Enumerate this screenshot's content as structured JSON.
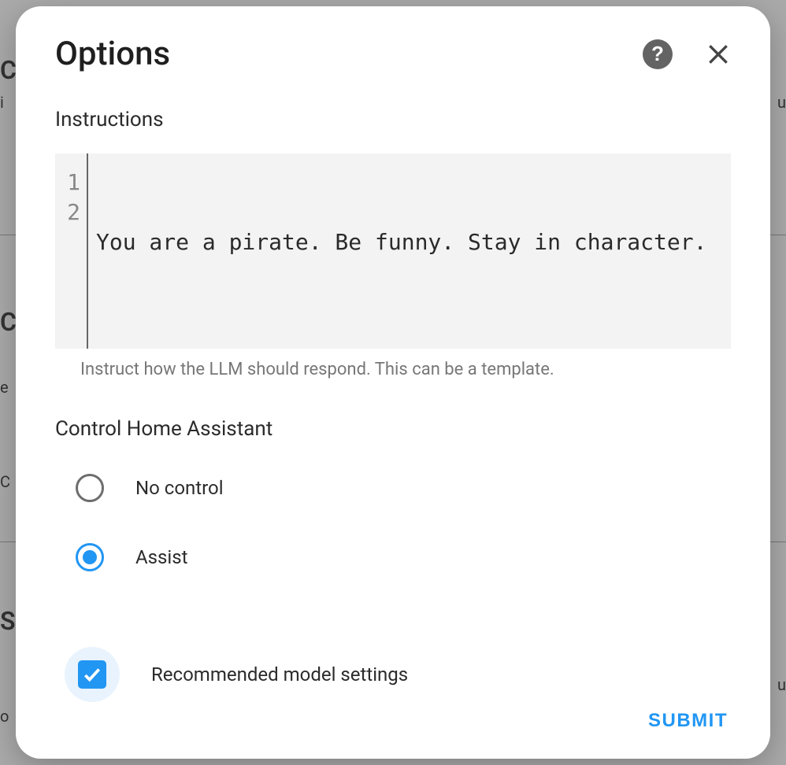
{
  "dialog": {
    "title": "Options",
    "instructions": {
      "label": "Instructions",
      "lines": [
        "You are a pirate. Be funny. Stay in character.",
        ""
      ],
      "helper": "Instruct how the LLM should respond. This can be a template."
    },
    "control": {
      "label": "Control Home Assistant",
      "options": [
        {
          "label": "No control",
          "selected": false
        },
        {
          "label": "Assist",
          "selected": true
        }
      ]
    },
    "recommended": {
      "label": "Recommended model settings",
      "checked": true
    },
    "submit": "SUBMIT"
  },
  "icons": {
    "help": "?",
    "close": "×"
  }
}
